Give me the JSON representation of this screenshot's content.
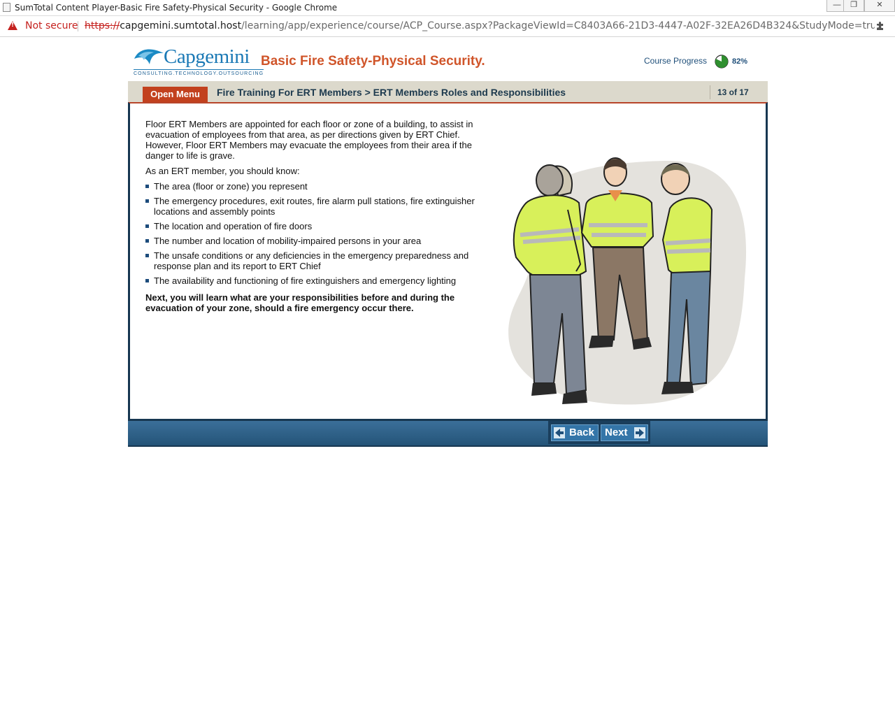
{
  "browser": {
    "window_title": "SumTotal Content Player-Basic Fire Safety-Physical Security - Google Chrome",
    "security_label": "Not secure",
    "url_scheme": "https://",
    "url_host": "capgemini.sumtotal.host",
    "url_path": "/learning/app/experience/course/ACP_Course.aspx?PackageViewId=C8403A66-21D3-4447-A02F-32EA26D4B324&StudyMode=true&InSchedule=t..."
  },
  "header": {
    "logo_wordmark": "Capgemini",
    "logo_tagline": "CONSULTING.TECHNOLOGY.OUTSOURCING",
    "course_title": "Basic Fire Safety-Physical Security.",
    "progress_label": "Course Progress",
    "progress_percent_text": "82%",
    "progress_fraction": 0.82
  },
  "navbar": {
    "open_menu_label": "Open Menu",
    "breadcrumb": "Fire Training For ERT Members > ERT Members Roles and Responsibilities",
    "pager": "13 of 17"
  },
  "content": {
    "intro": "Floor ERT Members are appointed for each floor or zone of a building, to assist in evacuation of employees from that area, as per directions given by ERT Chief. However, Floor ERT Members may evacuate the employees from their area if the danger to life is grave.",
    "know_heading": "As an ERT member, you should know:",
    "bullets": [
      "The area (floor or zone) you represent",
      "The emergency procedures, exit routes, fire alarm pull stations, fire extinguisher locations and assembly points",
      "The location and operation of fire doors",
      "The number and location of mobility-impaired persons in your area",
      "The unsafe conditions or any deficiencies in the emergency preparedness and response plan and its report to ERT Chief",
      "The availability and functioning of fire extinguishers and emergency lighting"
    ],
    "closing": "Next, you will learn what are your responsibilities before and during the evacuation of your zone, should a fire emergency occur there."
  },
  "footer": {
    "back_label": "Back",
    "next_label": "Next"
  },
  "colors": {
    "accent_orange": "#d0552a",
    "menu_red": "#c2411e",
    "navy": "#173751",
    "footer_blue": "#2f6591",
    "vest_yellow": "#d8f05a"
  }
}
